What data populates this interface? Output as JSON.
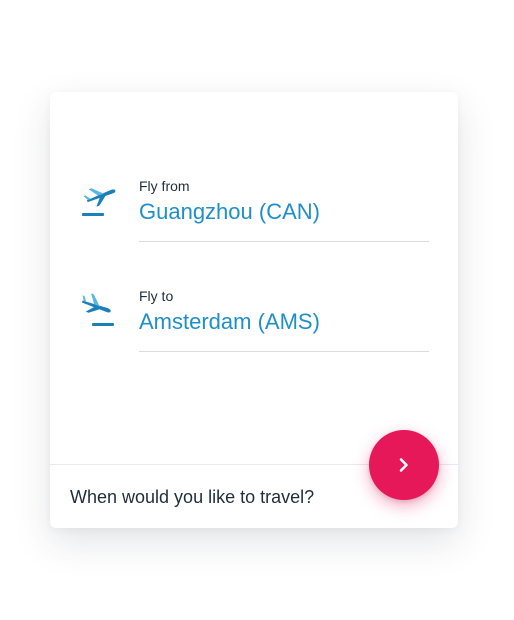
{
  "colors": {
    "accent": "#1f8fc9",
    "icon_dark": "#1b7fb8",
    "icon_light": "#5bb6e2",
    "text_dark": "#1f2d3d",
    "button": "#e6185a",
    "divider": "#d8dbe0"
  },
  "from": {
    "label": "Fly from",
    "value": "Guangzhou (CAN)",
    "icon": "plane-departure-icon"
  },
  "to": {
    "label": "Fly to",
    "value": "Amsterdam (AMS)",
    "icon": "plane-arrival-icon"
  },
  "date_prompt": "When would you like to travel?",
  "next_button": {
    "icon": "chevron-right-icon"
  }
}
